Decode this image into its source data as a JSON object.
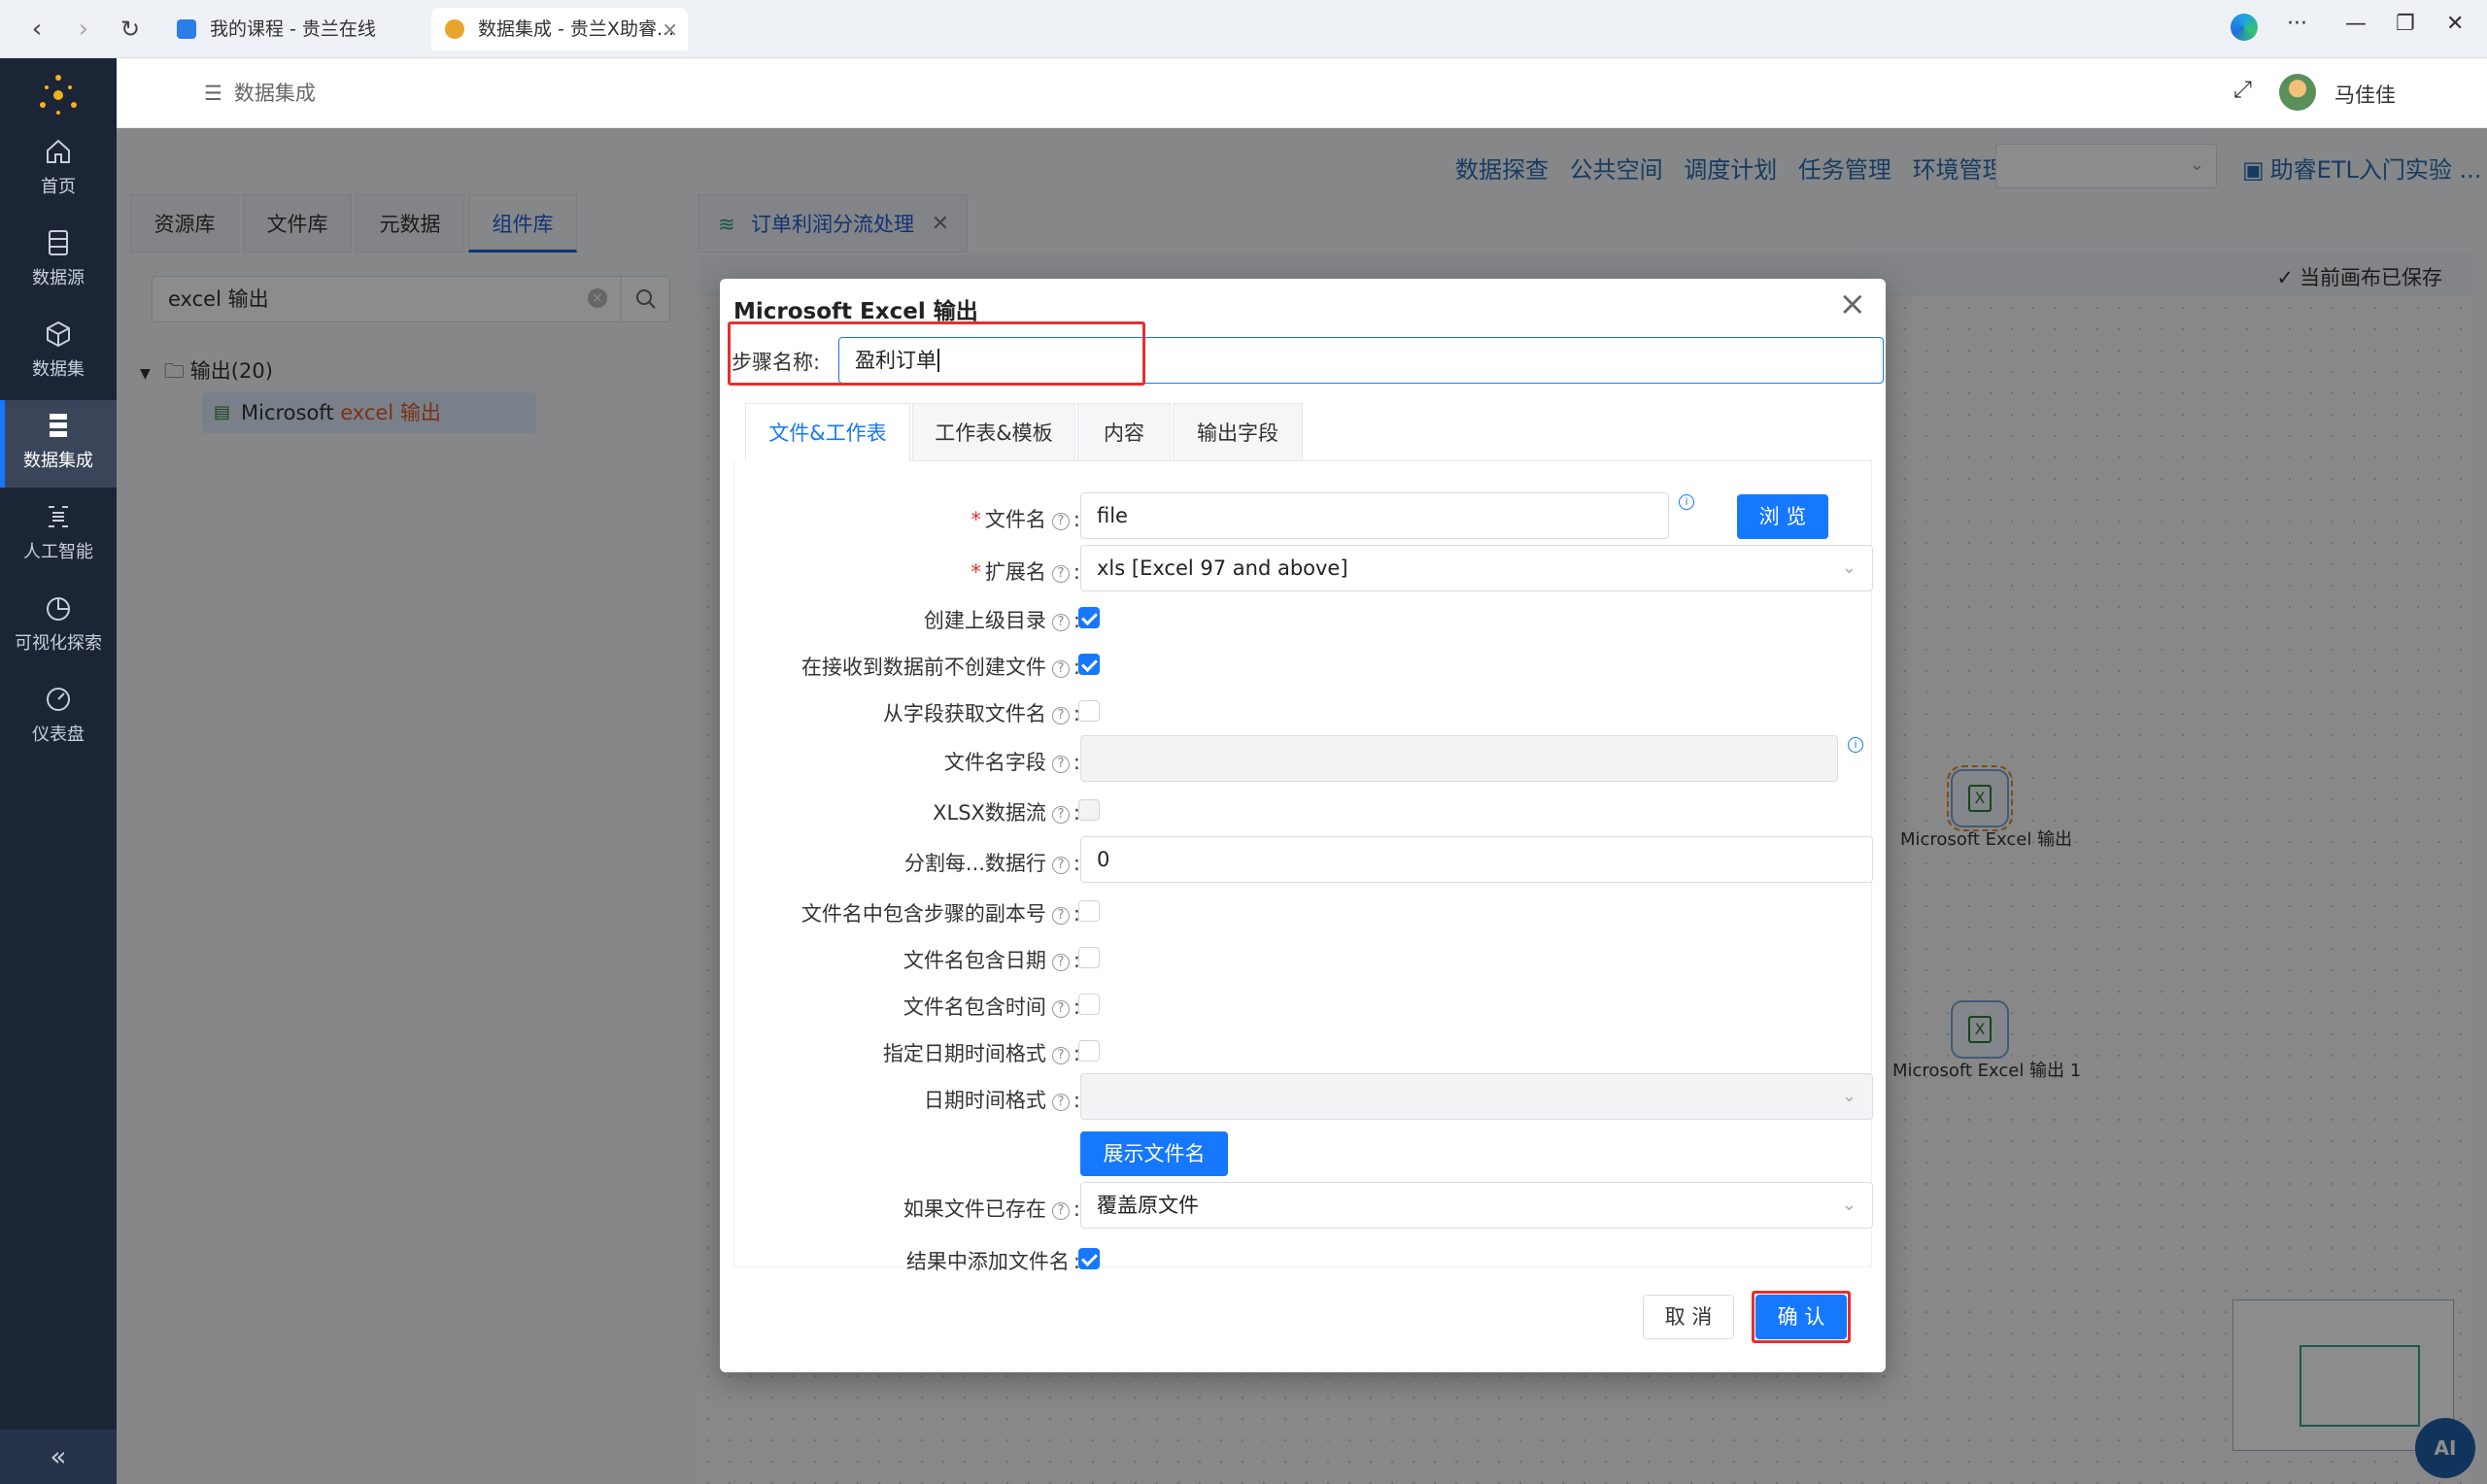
{
  "browser": {
    "tabs": [
      {
        "title": "我的课程 - 贵兰在线"
      },
      {
        "title": "数据集成 - 贵兰X助睿...",
        "active": true
      }
    ]
  },
  "sidebar": {
    "items": [
      {
        "label": "首页",
        "icon": "home-icon"
      },
      {
        "label": "数据源",
        "icon": "datasource-icon"
      },
      {
        "label": "数据集",
        "icon": "dataset-icon"
      },
      {
        "label": "数据集成",
        "icon": "integration-icon",
        "active": true
      },
      {
        "label": "人工智能",
        "icon": "ai-icon"
      },
      {
        "label": "可视化探索",
        "icon": "chart-icon"
      },
      {
        "label": "仪表盘",
        "icon": "dashboard-icon"
      }
    ],
    "collapse": "«"
  },
  "header": {
    "breadcrumb": "数据集成",
    "username": "马佳佳"
  },
  "toplinks": [
    "数据探查",
    "公共空间",
    "调度计划",
    "任务管理",
    "环境管理"
  ],
  "helper_link": "助睿ETL入门实验 ...",
  "library": {
    "tabs": [
      "资源库",
      "文件库",
      "元数据",
      "组件库"
    ],
    "active_tab": "组件库",
    "search_value": "excel 输出",
    "folder": "输出(20)",
    "item_prefix": "Microsoft ",
    "item_highlight": "excel 输出"
  },
  "canvas": {
    "tab_title": "订单利润分流处理",
    "saved_status": "当前画布已保存",
    "nodes": [
      {
        "label": "Microsoft Excel 输出"
      },
      {
        "label": "Microsoft Excel 输出 1"
      }
    ],
    "ai_button": "AI"
  },
  "dialog": {
    "title": "Microsoft Excel 输出",
    "step_label": "步骤名称",
    "step_value": "盈利订单",
    "tabs": [
      "文件&工作表",
      "工作表&模板",
      "内容",
      "输出字段"
    ],
    "active_tab": "文件&工作表",
    "form": {
      "filename_label": "文件名",
      "filename_value": "file",
      "browse_button": "浏 览",
      "extension_label": "扩展名",
      "extension_value": "xls [Excel 97 and above]",
      "create_parent_label": "创建上级目录",
      "create_parent": true,
      "no_create_before_data_label": "在接收到数据前不创建文件",
      "no_create_before_data": true,
      "filename_from_field_label": "从字段获取文件名",
      "filename_from_field": false,
      "filename_field_label": "文件名字段",
      "xlsx_stream_label": "XLSX数据流",
      "split_rows_label": "分割每...数据行",
      "split_rows_value": "0",
      "include_copy_label": "文件名中包含步骤的副本号",
      "include_date_label": "文件名包含日期",
      "include_time_label": "文件名包含时间",
      "specify_datetime_format_label": "指定日期时间格式",
      "datetime_format_label": "日期时间格式",
      "show_filename_button": "展示文件名",
      "if_exists_label": "如果文件已存在",
      "if_exists_value": "覆盖原文件",
      "add_to_result_label": "结果中添加文件名",
      "add_to_result": true
    },
    "cancel_button": "取 消",
    "confirm_button": "确 认"
  }
}
